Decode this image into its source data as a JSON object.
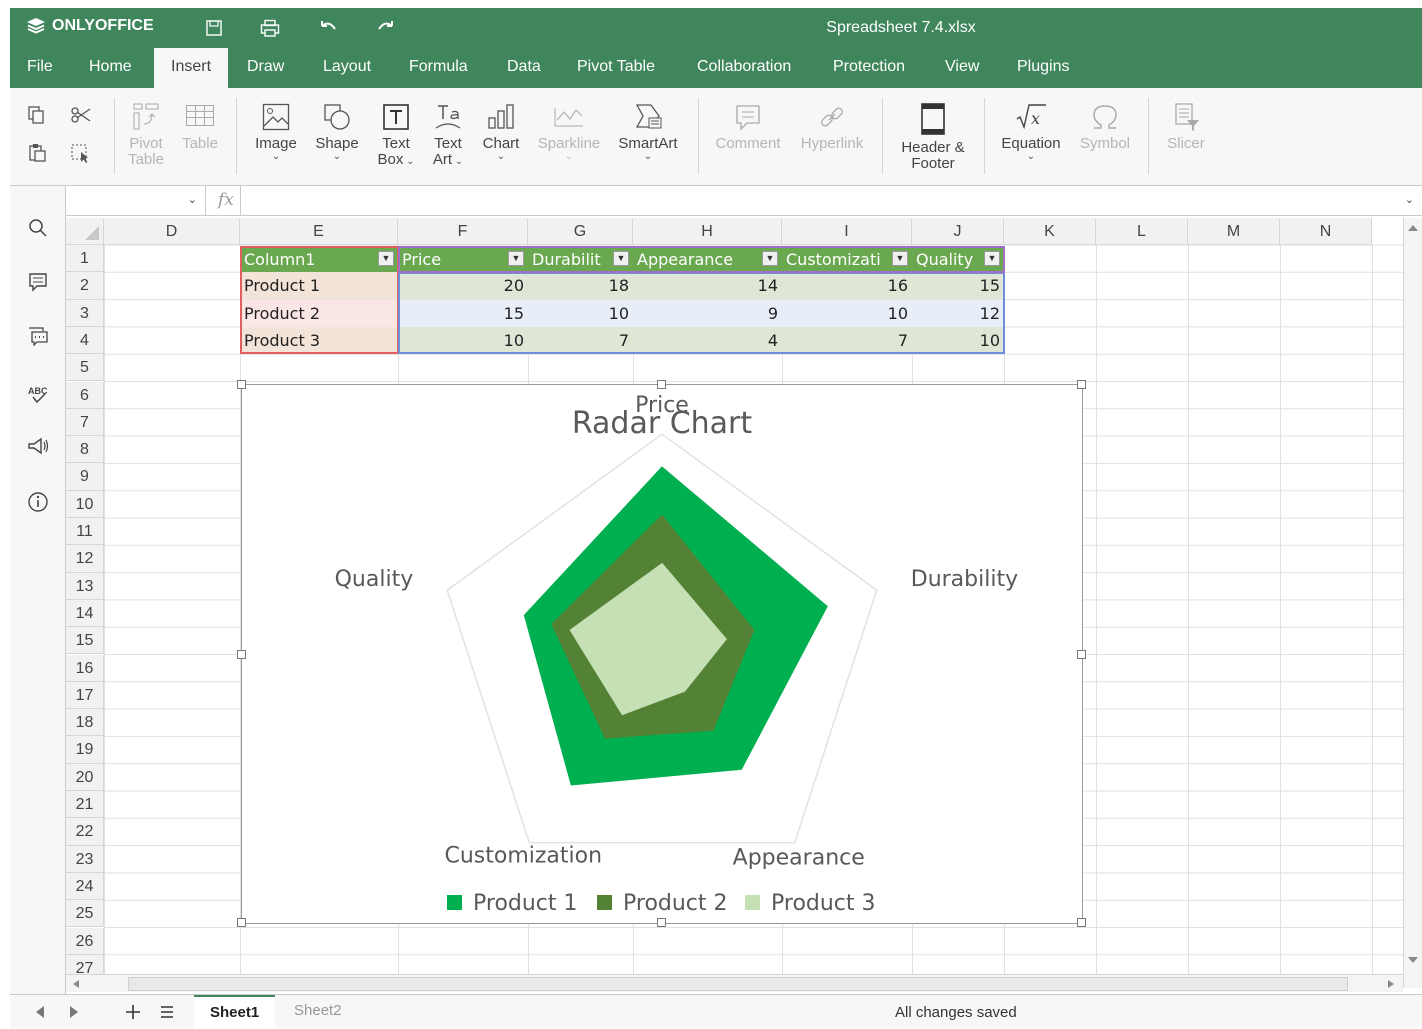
{
  "app": {
    "brand": "ONLYOFFICE",
    "title": "Spreadsheet 7.4.xlsx"
  },
  "menu": [
    "File",
    "Home",
    "Insert",
    "Draw",
    "Layout",
    "Formula",
    "Data",
    "Pivot Table",
    "Collaboration",
    "Protection",
    "View",
    "Plugins"
  ],
  "active_tab": "Insert",
  "toolbar": {
    "pivot": [
      "Pivot",
      "Table"
    ],
    "table": "Table",
    "image": "Image",
    "shape": "Shape",
    "textbox": [
      "Text",
      "Box"
    ],
    "textart": [
      "Text",
      "Art"
    ],
    "chart": "Chart",
    "sparkline": "Sparkline",
    "smartart": "SmartArt",
    "comment": "Comment",
    "hyperlink": "Hyperlink",
    "header": [
      "Header &",
      "Footer"
    ],
    "equation": "Equation",
    "symbol": "Symbol",
    "slicer": "Slicer"
  },
  "formula_bar": {
    "name_box": "",
    "fx": "fx",
    "value": ""
  },
  "columns": [
    "D",
    "E",
    "F",
    "G",
    "H",
    "I",
    "J",
    "K",
    "L",
    "M",
    "N"
  ],
  "rows": [
    "1",
    "2",
    "3",
    "4",
    "5",
    "6",
    "7",
    "8",
    "9",
    "10",
    "11",
    "12",
    "13",
    "14",
    "15",
    "16",
    "17",
    "18",
    "19",
    "20",
    "21",
    "22",
    "23",
    "24",
    "25",
    "26",
    "27"
  ],
  "table": {
    "headers": [
      "Column1",
      "Price",
      "Durabilit",
      "Appearance",
      "Customizati",
      "Quality"
    ],
    "rows": [
      {
        "name": "Product 1",
        "values": [
          "20",
          "18",
          "14",
          "16",
          "15"
        ]
      },
      {
        "name": "Product 2",
        "values": [
          "15",
          "10",
          "9",
          "10",
          "12"
        ]
      },
      {
        "name": "Product 3",
        "values": [
          "10",
          "7",
          "4",
          "7",
          "10"
        ]
      }
    ]
  },
  "chart_data": {
    "type": "radar",
    "title": "Radar Chart",
    "categories": [
      "Price",
      "Durability",
      "Appearance",
      "Customization",
      "Quality"
    ],
    "series": [
      {
        "name": "Product 1",
        "values": [
          20,
          18,
          14,
          16,
          15
        ],
        "color": "#00b050"
      },
      {
        "name": "Product 2",
        "values": [
          15,
          10,
          9,
          10,
          12
        ],
        "color": "#548235"
      },
      {
        "name": "Product 3",
        "values": [
          10,
          7,
          4,
          7,
          10
        ],
        "color": "#c5e0b4"
      }
    ],
    "max": 20,
    "legend": "bottom"
  },
  "sheets": [
    "Sheet1",
    "Sheet2"
  ],
  "active_sheet": "Sheet1",
  "status": "All changes saved",
  "colors": {
    "brand": "#40865c",
    "header_fill": "#6aa84f"
  }
}
